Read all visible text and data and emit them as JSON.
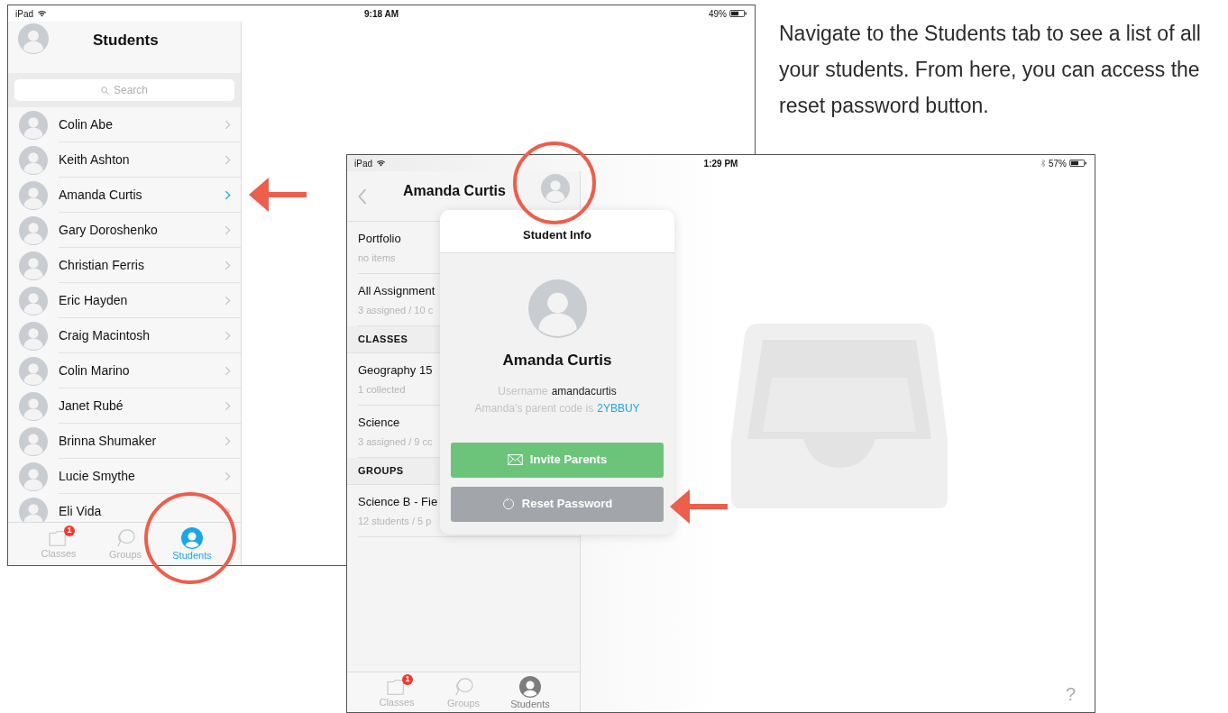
{
  "caption": "Navigate to the Students tab to see a list of all your students. From here, you can access the reset password button.",
  "screenshot_1": {
    "status_bar": {
      "device": "iPad",
      "time": "9:18 AM",
      "battery": "49%"
    },
    "title": "Students",
    "search": {
      "placeholder": "Search"
    },
    "students": [
      {
        "name": "Colin Abe",
        "selected": false
      },
      {
        "name": "Keith Ashton",
        "selected": false
      },
      {
        "name": "Amanda Curtis",
        "selected": true
      },
      {
        "name": "Gary Doroshenko",
        "selected": false
      },
      {
        "name": "Christian Ferris",
        "selected": false
      },
      {
        "name": "Eric Hayden",
        "selected": false
      },
      {
        "name": "Craig Macintosh",
        "selected": false
      },
      {
        "name": "Colin Marino",
        "selected": false
      },
      {
        "name": "Janet Rubé",
        "selected": false
      },
      {
        "name": "Brinna Shumaker",
        "selected": false
      },
      {
        "name": "Lucie Smythe",
        "selected": false
      },
      {
        "name": "Eli Vida",
        "selected": false
      }
    ],
    "tab_bar": [
      {
        "kind": "classes",
        "label": "Classes",
        "badge": "1",
        "selected": false
      },
      {
        "kind": "groups",
        "label": "Groups",
        "selected": false
      },
      {
        "kind": "students",
        "label": "Students",
        "selected": true
      }
    ]
  },
  "screenshot_2": {
    "status_bar": {
      "device": "iPad",
      "time": "1:29 PM",
      "battery": "57%"
    },
    "title": "Amanda Curtis",
    "list": [
      {
        "kind": "item",
        "title": "Portfolio",
        "subtitle": "no items"
      },
      {
        "kind": "item",
        "title": "All Assignment",
        "subtitle": "3 assigned / 10 c"
      },
      {
        "kind": "header",
        "title": "CLASSES"
      },
      {
        "kind": "item",
        "title": "Geography 15",
        "subtitle": "1 collected"
      },
      {
        "kind": "item",
        "title": "Science",
        "subtitle": "3 assigned / 9 cc"
      },
      {
        "kind": "header",
        "title": "GROUPS"
      },
      {
        "kind": "item",
        "title": "Science B - Fie",
        "subtitle": "12 students / 5 p"
      }
    ],
    "popover": {
      "title": "Student Info",
      "name": "Amanda Curtis",
      "username_label": "Username",
      "username": "amandacurtis",
      "parent_code_text": "Amanda’s parent code is",
      "parent_code": "2YBBUY",
      "buttons": [
        {
          "kind": "invite",
          "label": "Invite Parents"
        },
        {
          "kind": "reset",
          "label": "Reset Password"
        }
      ]
    },
    "tab_bar": [
      {
        "kind": "classes",
        "label": "Classes",
        "badge": "1",
        "selected": false
      },
      {
        "kind": "groups",
        "label": "Groups",
        "selected": false
      },
      {
        "kind": "students",
        "label": "Students",
        "selected": true
      }
    ],
    "help": "?"
  }
}
